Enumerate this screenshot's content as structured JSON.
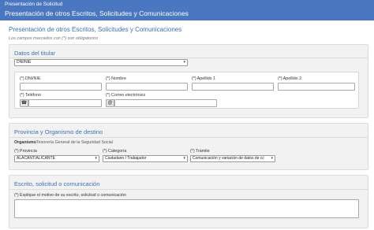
{
  "header": {
    "section": "Presentación de Solicitud",
    "title": "Presentación de otros Escritos, Solicitudes y Comunicaciones"
  },
  "page": {
    "title": "Presentación de otros Escritos, Solicitudes y Comunicaciones",
    "required_note": "Los campos marcados con (*) son obligatorios"
  },
  "titular": {
    "title": "Datos del titular",
    "doc_type": "DNI/NIE",
    "fields": {
      "dni_label": "(*) DNI/NIE",
      "nombre_label": "(*) Nombre",
      "apellido1_label": "(*) Apellido 1",
      "apellido2_label": "(*) Apellido 2",
      "telefono_label": "(*) Teléfono",
      "email_label": "(*) Correo electrónico"
    },
    "icons": {
      "phone": "phone-icon",
      "email": "at-icon"
    }
  },
  "destino": {
    "title": "Provincia y Organismo de destino",
    "organismo_label": "Organismo",
    "organismo_value": "Tesorería General de la Seguridad Social",
    "provincia_label": "(*) Provincia",
    "provincia_value": "ALACANT/ALICANTE",
    "categoria_label": "(*) Categoría",
    "categoria_value": "Ciudadano / Trabajador",
    "tramite_label": "(*) Trámite",
    "tramite_value": "Comunicación y variación de datos de cc"
  },
  "escrito": {
    "title": "Escrito, solicitud o comunicación",
    "motivo_label": "(*) Explique el motivo de su escrito, solicitud o comunicación"
  },
  "colors": {
    "header_bg": "#4a77c0",
    "accent": "#3f6fb7"
  }
}
